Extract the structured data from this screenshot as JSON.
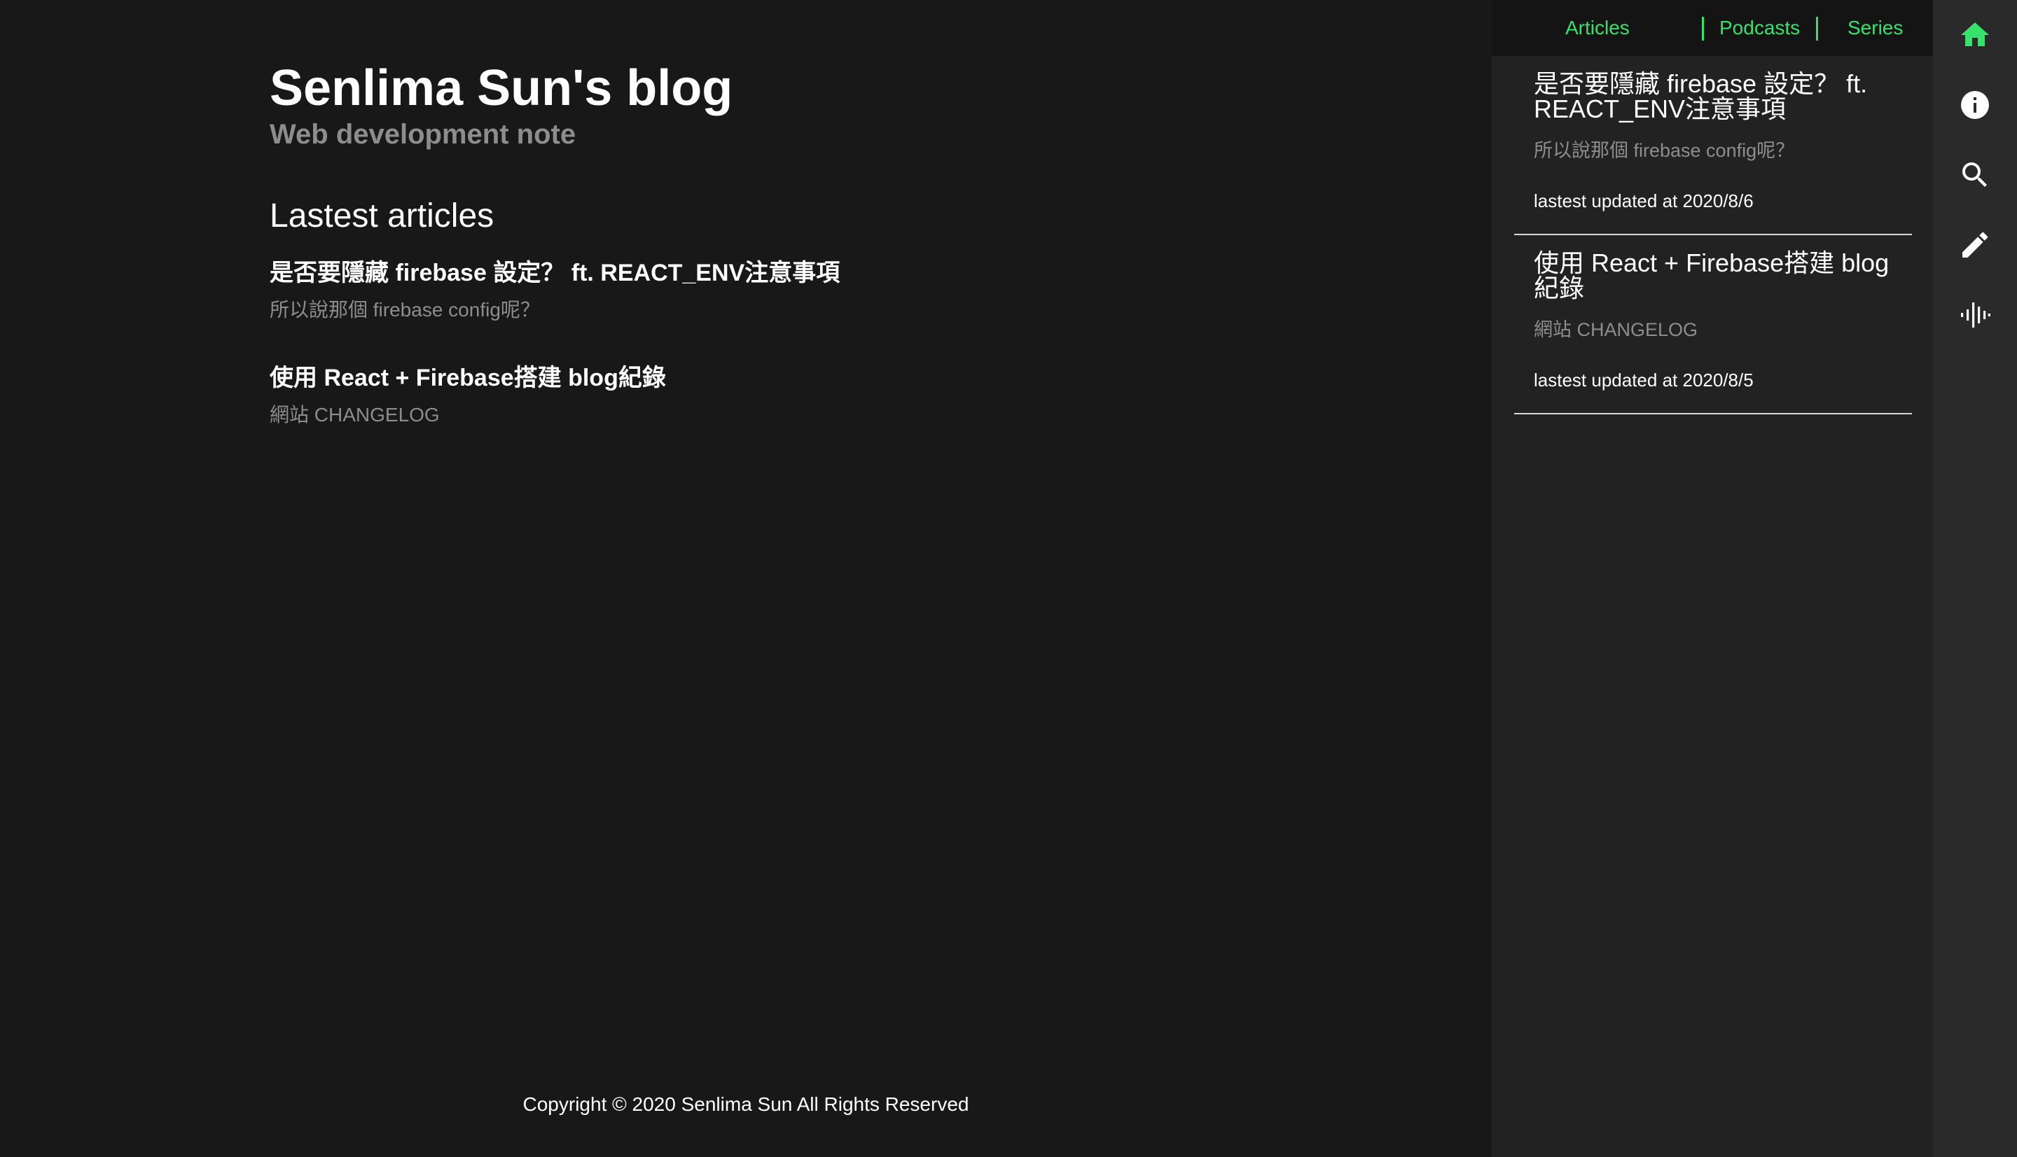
{
  "main": {
    "blog_title": "Senlima Sun's blog",
    "blog_subtitle": "Web development note",
    "section_heading": "Lastest articles",
    "articles": [
      {
        "title": "是否要隱藏 firebase 設定？ ft. REACT_ENV注意事項",
        "description": "所以說那個 firebase config呢？"
      },
      {
        "title": "使用 React + Firebase搭建 blog紀錄",
        "description": "網站 CHANGELOG"
      }
    ],
    "footer": "Copyright © 2020 Senlima Sun All Rights Reserved"
  },
  "side_panel": {
    "tabs": [
      {
        "label": "Articles"
      },
      {
        "label": "Podcasts"
      },
      {
        "label": "Series"
      }
    ],
    "cards": [
      {
        "title": "是否要隱藏 firebase 設定？ ft. REACT_ENV注意事項",
        "description": "所以說那個 firebase config呢？",
        "updated": "lastest updated at 2020/8/6"
      },
      {
        "title": "使用 React + Firebase搭建 blog紀錄",
        "description": "網站 CHANGELOG",
        "updated": "lastest updated at 2020/8/5"
      }
    ]
  },
  "icon_rail": {
    "items": [
      {
        "icon": "home-icon",
        "active": true
      },
      {
        "icon": "info-icon",
        "active": false
      },
      {
        "icon": "search-icon",
        "active": false
      },
      {
        "icon": "pencil-icon",
        "active": false
      },
      {
        "icon": "audio-waveform-icon",
        "active": false
      }
    ]
  },
  "colors": {
    "background": "#181818",
    "side_panel": "#222222",
    "tab_bar": "#141414",
    "icon_rail": "#2a2a2a",
    "accent": "#35e36a",
    "muted_text": "#8d8d8d",
    "text": "#ffffff"
  }
}
